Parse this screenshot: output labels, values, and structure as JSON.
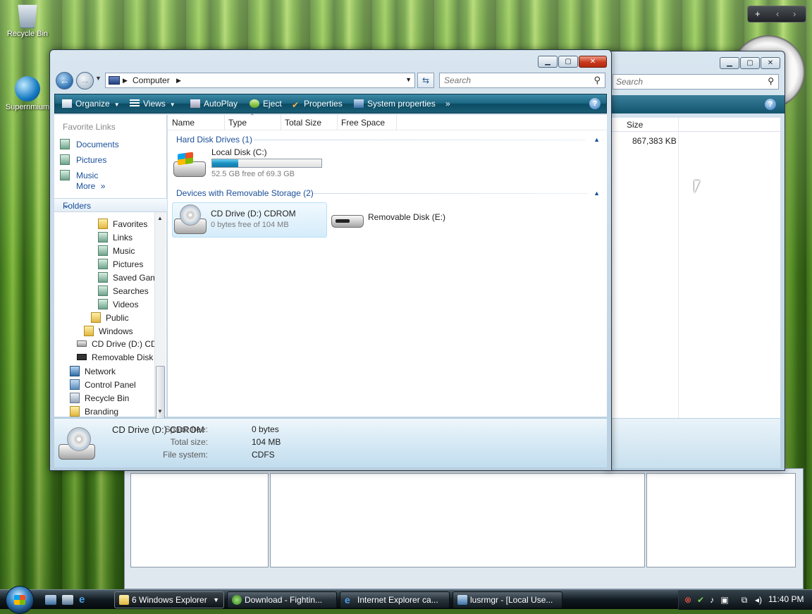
{
  "desktop": {
    "icons": [
      {
        "label": "Recycle Bin",
        "icon": "recycle-bin-icon"
      },
      {
        "label": "Supernmium",
        "icon": "app-globe-icon"
      }
    ]
  },
  "back_window": {
    "search_placeholder": "Search",
    "size_header": "Size",
    "size_value": "867,383 KB"
  },
  "main_window": {
    "address": {
      "crumb": "Computer",
      "search_placeholder": "Search"
    },
    "commands": [
      {
        "label": "Organize",
        "icon": "organize-icon"
      },
      {
        "label": "Views",
        "icon": "views-icon"
      },
      {
        "label": "AutoPlay",
        "icon": "autoplay-icon"
      },
      {
        "label": "Eject",
        "icon": "eject-icon"
      },
      {
        "label": "Properties",
        "icon": "properties-icon"
      },
      {
        "label": "System properties",
        "icon": "system-properties-icon"
      }
    ],
    "nav": {
      "favorite_links_title": "Favorite Links",
      "favorites": [
        "Documents",
        "Pictures",
        "Music"
      ],
      "more": "More",
      "folders_title": "Folders",
      "tree": [
        "Favorites",
        "Links",
        "Music",
        "Pictures",
        "Saved Gam",
        "Searches",
        "Videos",
        "Public",
        "Windows",
        "CD Drive (D:) CD",
        "Removable Disk",
        "Network",
        "Control Panel",
        "Recycle Bin",
        "Branding"
      ]
    },
    "columns": [
      "Name",
      "Type",
      "Total Size",
      "Free Space"
    ],
    "groups": {
      "hdd": "Hard Disk Drives (1)",
      "removable": "Devices with Removable Storage (2)"
    },
    "drives": {
      "local": {
        "name": "Local Disk (C:)",
        "sub": "52.5 GB free of 69.3 GB",
        "used_fraction": 0.24
      },
      "cd": {
        "name": "CD Drive (D:) CDROM",
        "sub": "0 bytes free of 104 MB"
      },
      "removable": {
        "name": "Removable Disk (E:)"
      }
    },
    "details": {
      "name": "CD Drive (D:) CDROM",
      "space_free_label": "Space free:",
      "space_free": "0 bytes",
      "total_size_label": "Total size:",
      "total_size": "104 MB",
      "file_system_label": "File system:",
      "file_system": "CDFS"
    }
  },
  "taskbar": {
    "buttons": [
      {
        "label": "6 Windows Explorer",
        "icon": "folder-icon"
      },
      {
        "label": "Download - Fightin...",
        "icon": "browser-icon"
      },
      {
        "label": "Internet Explorer ca...",
        "icon": "ie-icon"
      },
      {
        "label": "lusrmgr - [Local Use...",
        "icon": "mmc-icon"
      }
    ],
    "clock": "11:40 PM"
  },
  "colors": {
    "link_blue": "#1a4f9a",
    "command_bar": "#1c6682",
    "progress_fill": "#1b8fc1"
  }
}
